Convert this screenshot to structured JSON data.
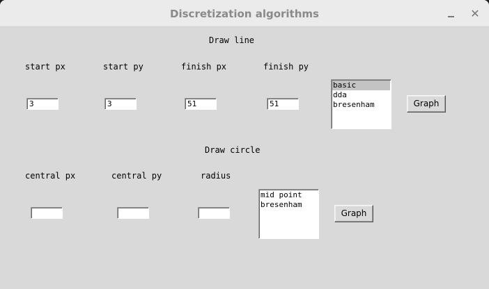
{
  "window": {
    "title": "Discretization algorithms"
  },
  "line_section": {
    "heading": "Draw line",
    "labels": {
      "start_px": "start px",
      "start_py": "start py",
      "finish_px": "finish px",
      "finish_py": "finish py"
    },
    "values": {
      "start_px": "3",
      "start_py": "3",
      "finish_px": "51",
      "finish_py": "51"
    },
    "algorithms": [
      "basic",
      "dda",
      "bresenham"
    ],
    "selected_algorithm": "basic",
    "graph_button": "Graph"
  },
  "circle_section": {
    "heading": "Draw circle",
    "labels": {
      "central_px": "central px",
      "central_py": "central py",
      "radius": "radius"
    },
    "values": {
      "central_px": "",
      "central_py": "",
      "radius": ""
    },
    "algorithms": [
      "mid point",
      "bresenham"
    ],
    "graph_button": "Graph"
  }
}
